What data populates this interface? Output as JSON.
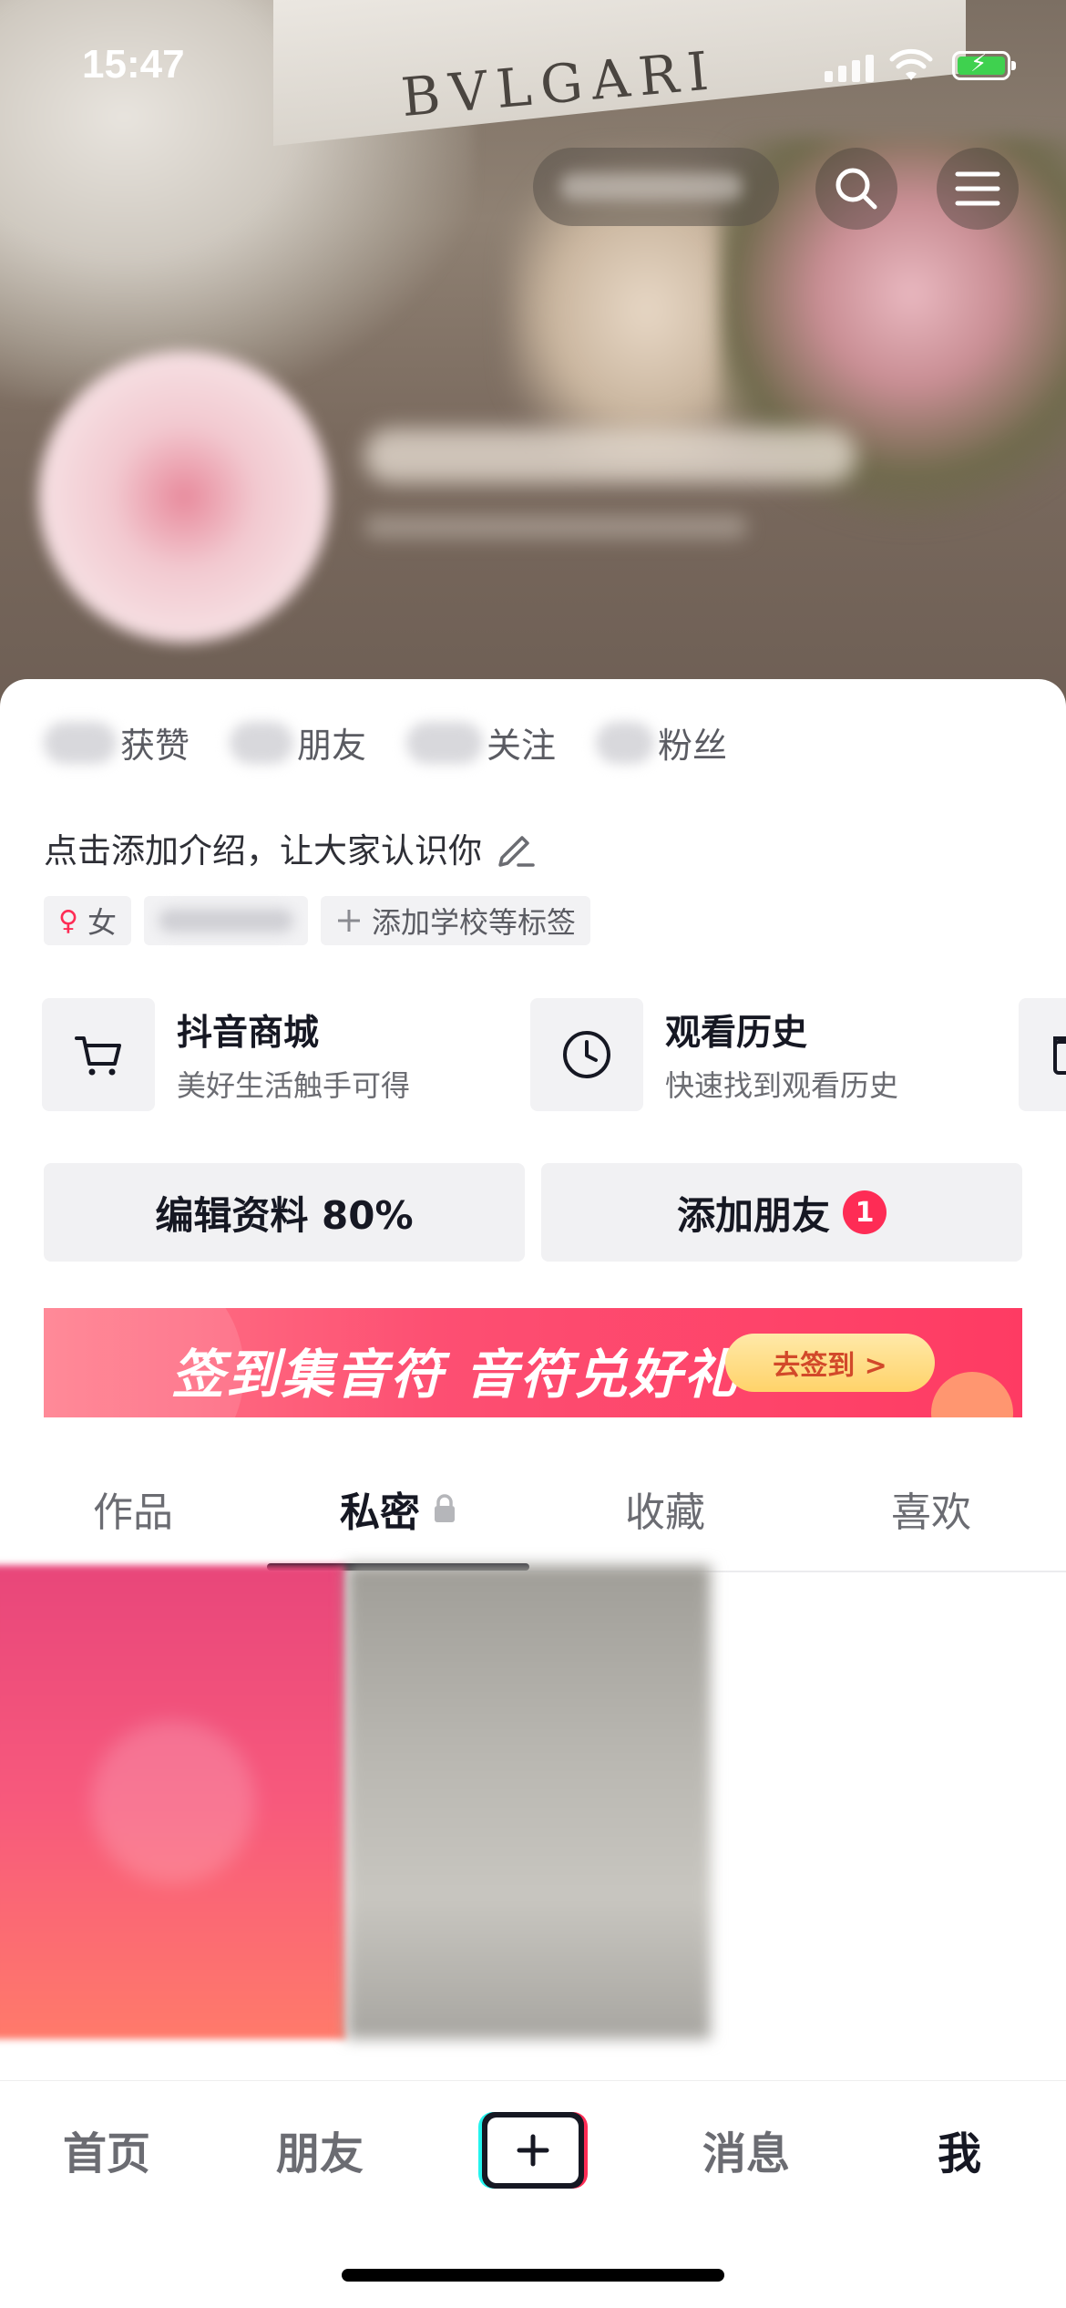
{
  "status_bar": {
    "time": "15:47"
  },
  "header": {
    "background_brand_text": "BVLGARI",
    "visitor_label": ""
  },
  "profile": {
    "stats": [
      {
        "label": "获赞"
      },
      {
        "label": "朋友"
      },
      {
        "label": "关注"
      },
      {
        "label": "粉丝"
      }
    ],
    "bio_placeholder": "点击添加介绍，让大家认识你",
    "tags": {
      "gender": "女",
      "add_tag": "添加学校等标签"
    }
  },
  "services": [
    {
      "title": "抖音商城",
      "subtitle": "美好生活触手可得",
      "icon": "cart-icon"
    },
    {
      "title": "观看历史",
      "subtitle": "快速找到观看历史",
      "icon": "clock-icon"
    }
  ],
  "actions": {
    "edit_profile": "编辑资料 80%",
    "add_friend": "添加朋友",
    "add_friend_badge": "1"
  },
  "banner": {
    "title": "签到集音符 音符兑好礼",
    "cta": "去签到 >"
  },
  "content_tabs": [
    {
      "label": "作品"
    },
    {
      "label": "私密",
      "locked": true
    },
    {
      "label": "收藏"
    },
    {
      "label": "喜欢"
    }
  ],
  "active_tab": "私密",
  "bottom_nav": {
    "home": "首页",
    "friends": "朋友",
    "messages": "消息",
    "me": "我"
  },
  "colors": {
    "accent": "#fe2c55",
    "cyan": "#25f4ee",
    "text": "#161823",
    "battery": "#3fd14f"
  }
}
